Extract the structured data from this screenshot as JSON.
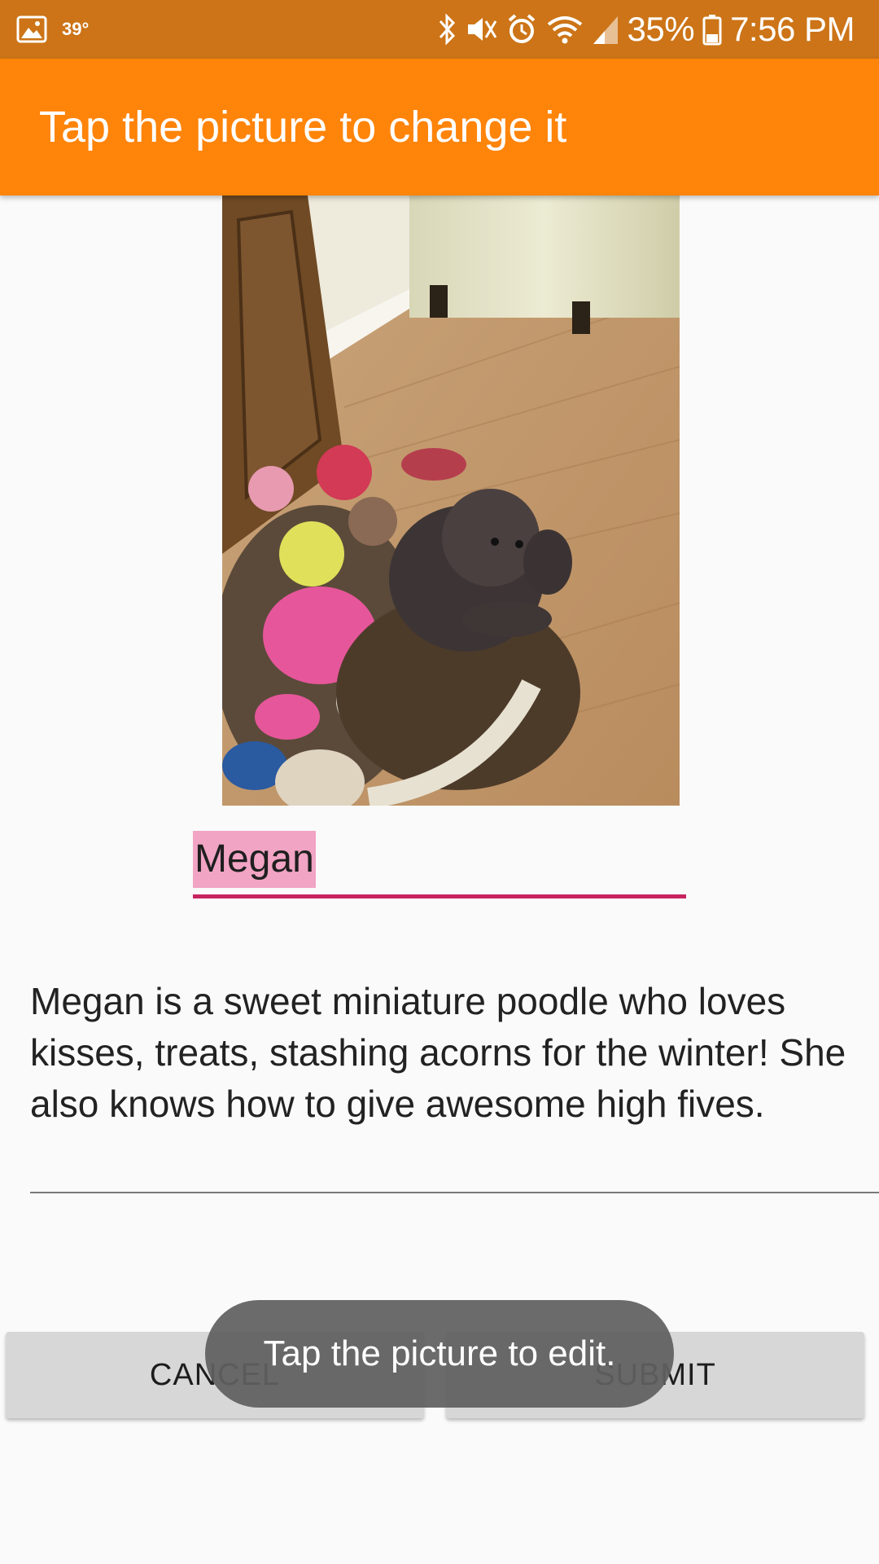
{
  "status_bar": {
    "temperature": "39°",
    "battery_percent": "35%",
    "time": "7:56 PM",
    "icons": [
      "gallery-icon",
      "bluetooth-icon",
      "vibrate-icon",
      "alarm-icon",
      "wifi-icon",
      "signal-icon",
      "battery-icon"
    ]
  },
  "toolbar": {
    "title": "Tap the picture to change it",
    "color": "#ff840a"
  },
  "pet": {
    "name": "Megan",
    "description": "Megan is a sweet miniature poodle who loves kisses, treats, stashing acorns for the winter! She also knows how to give awesome high fives."
  },
  "buttons": {
    "cancel_label": "CANCEL",
    "submit_label": "SUBMIT"
  },
  "toast": {
    "message": "Tap the picture to edit."
  },
  "colors": {
    "status_bar": "#cc7417",
    "accent": "#c8245f",
    "name_highlight": "#f1a4c3"
  }
}
